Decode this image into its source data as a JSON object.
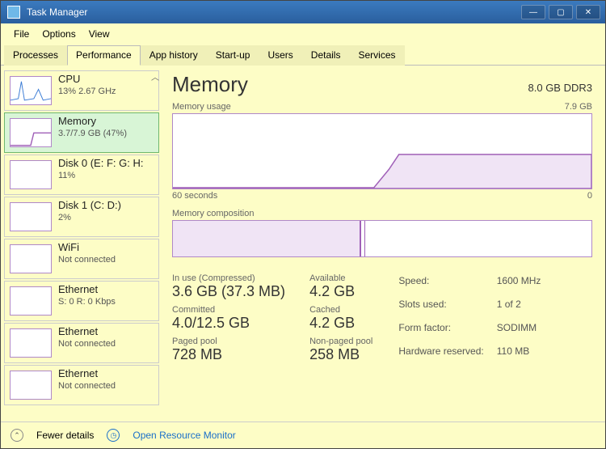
{
  "window": {
    "title": "Task Manager"
  },
  "menu": {
    "file": "File",
    "options": "Options",
    "view": "View"
  },
  "tabs": {
    "processes": "Processes",
    "performance": "Performance",
    "app_history": "App history",
    "startup": "Start-up",
    "users": "Users",
    "details": "Details",
    "services": "Services"
  },
  "sidebar": {
    "cpu": {
      "name": "CPU",
      "stat": "13% 2.67 GHz"
    },
    "memory": {
      "name": "Memory",
      "stat": "3.7/7.9 GB (47%)"
    },
    "disk0": {
      "name": "Disk 0 (E: F: G: H:",
      "stat": "11%"
    },
    "disk1": {
      "name": "Disk 1 (C: D:)",
      "stat": "2%"
    },
    "wifi": {
      "name": "WiFi",
      "stat": "Not connected"
    },
    "eth0": {
      "name": "Ethernet",
      "stat": "S: 0 R: 0 Kbps"
    },
    "eth1": {
      "name": "Ethernet",
      "stat": "Not connected"
    },
    "eth2": {
      "name": "Ethernet",
      "stat": "Not connected"
    }
  },
  "memory": {
    "title": "Memory",
    "capacity": "8.0 GB DDR3",
    "usage_label": "Memory usage",
    "usage_max": "7.9 GB",
    "axis_left": "60 seconds",
    "axis_right": "0",
    "comp_label": "Memory composition",
    "stats": {
      "inuse_label": "In use (Compressed)",
      "inuse": "3.6 GB (37.3 MB)",
      "available_label": "Available",
      "available": "4.2 GB",
      "committed_label": "Committed",
      "committed": "4.0/12.5 GB",
      "cached_label": "Cached",
      "cached": "4.2 GB",
      "paged_label": "Paged pool",
      "paged": "728 MB",
      "nonpaged_label": "Non-paged pool",
      "nonpaged": "258 MB"
    },
    "hw": {
      "speed_label": "Speed:",
      "speed": "1600 MHz",
      "slots_label": "Slots used:",
      "slots": "1 of 2",
      "form_label": "Form factor:",
      "form": "SODIMM",
      "reserved_label": "Hardware reserved:",
      "reserved": "110 MB"
    }
  },
  "footer": {
    "fewer": "Fewer details",
    "resmon": "Open Resource Monitor"
  },
  "chart_data": {
    "type": "line",
    "title": "Memory usage",
    "xlabel": "60 seconds → 0",
    "ylabel": "GB",
    "ylim": [
      0,
      7.9
    ],
    "x": [
      60,
      55,
      50,
      45,
      40,
      35,
      30,
      28,
      26,
      20,
      10,
      0
    ],
    "values": [
      0,
      0,
      0,
      0,
      0,
      0,
      0,
      1.8,
      3.5,
      3.6,
      3.6,
      3.6
    ]
  }
}
